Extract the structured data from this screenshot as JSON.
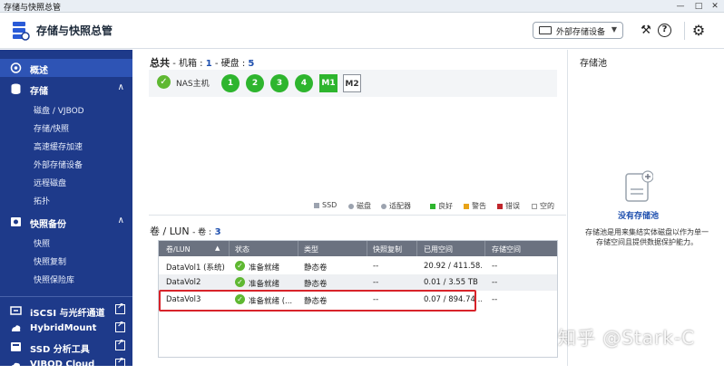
{
  "window": {
    "title": "存储与快照总管",
    "buttons": [
      "—",
      "□",
      "✕"
    ]
  },
  "header": {
    "app_title": "存储与快照总管",
    "external_device_label": "外部存储设备"
  },
  "sidebar": {
    "overview": "概述",
    "storage": "存储",
    "storage_items": [
      "磁盘 / VJBOD",
      "存储/快照",
      "高速缓存加速",
      "外部存储设备",
      "远程磁盘",
      "拓扑"
    ],
    "snapshot_backup": "快照备份",
    "snapshot_items": [
      "快照",
      "快照复制",
      "快照保险库"
    ],
    "links": [
      "iSCSI 与光纤通道",
      "HybridMount",
      "SSD 分析工具",
      "VJBOD Cloud"
    ]
  },
  "summary": {
    "label": "总共",
    "machines_label": "- 机箱 :",
    "machines": "1",
    "disks_label": "- 硬盘 :",
    "disks": "5",
    "nas_label": "NAS主机",
    "disk_slots": [
      "1",
      "2",
      "3",
      "4"
    ],
    "m_slots": [
      "M1",
      "M2"
    ]
  },
  "legend": [
    {
      "label": "SSD",
      "color": "#9ca3af",
      "shape": "square"
    },
    {
      "label": "磁盘",
      "color": "#9ca3af",
      "shape": "dot"
    },
    {
      "label": "适配器",
      "color": "#9ca3af",
      "shape": "dot"
    },
    {
      "label": "良好",
      "color": "#2eb52e",
      "shape": "square"
    },
    {
      "label": "警告",
      "color": "#e8a317",
      "shape": "square"
    },
    {
      "label": "错误",
      "color": "#c0262c",
      "shape": "square"
    },
    {
      "label": "空的",
      "color": "#ffffff",
      "shape": "square"
    }
  ],
  "volumes": {
    "title": "卷 / LUN",
    "count_label": "- 卷 :",
    "count": "3",
    "columns": [
      "卷/LUN",
      "状态",
      "类型",
      "快照复制",
      "已用空间",
      "存储空间"
    ],
    "rows": [
      {
        "name": "DataVol1 (系统)",
        "status": "准备就绪",
        "type": "静态卷",
        "replica": "--",
        "used": "20.92 / 411.58...",
        "pool": "--"
      },
      {
        "name": "DataVol2",
        "status": "准备就绪",
        "type": "静态卷",
        "replica": "--",
        "used": "0.01 / 3.55 TB",
        "pool": "--"
      },
      {
        "name": "DataVol3",
        "status": "准备就绪 (...",
        "type": "静态卷",
        "replica": "--",
        "used": "0.07 / 894.74 ...",
        "pool": "--"
      }
    ]
  },
  "storage_pool": {
    "title": "存储池",
    "empty_label": "没有存储池",
    "description": "存储池是用来集结实体磁盘以作为单一存储空间且提供数据保护能力。"
  },
  "watermark": "知乎 @Stark-C"
}
